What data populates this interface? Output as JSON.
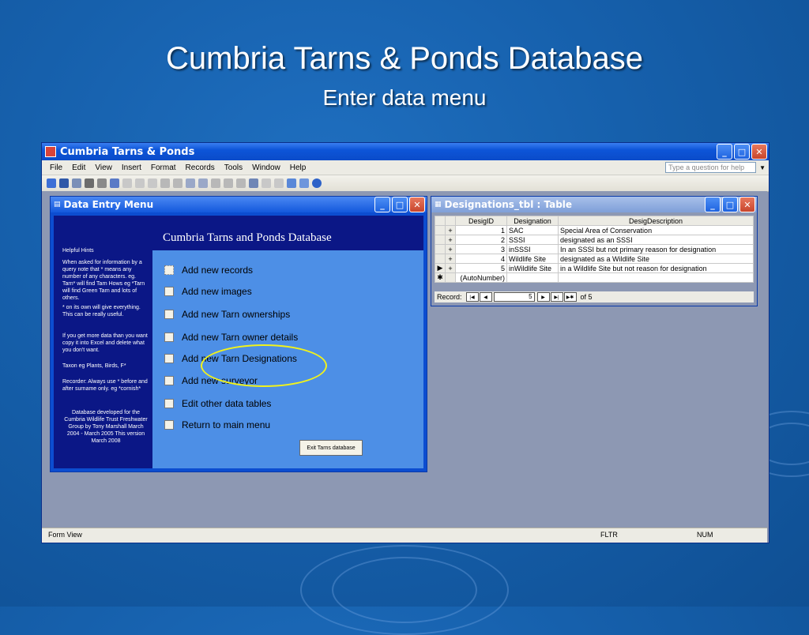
{
  "slide": {
    "title": "Cumbria Tarns & Ponds Database",
    "subtitle": "Enter data menu"
  },
  "app": {
    "title": "Cumbria Tarns & Ponds",
    "menu": [
      "File",
      "Edit",
      "View",
      "Insert",
      "Format",
      "Records",
      "Tools",
      "Window",
      "Help"
    ],
    "help_placeholder": "Type a question for help",
    "status": {
      "mode": "Form View",
      "filter": "FLTR",
      "num": "NUM"
    }
  },
  "menu_form": {
    "window_title": "Data Entry Menu",
    "heading": "Cumbria Tarns and Ponds Database",
    "hints": [
      "Helpful Hints",
      "When asked for information by a query note that * means any number of any characters. eg. Tarn* will find Tarn Hows eg *Tarn will find Green Tarn and lots of others.",
      "* on its own will give everything. This can be really useful.",
      "If you get more data than you want copy it into Excel and delete what you don't want.",
      "Taxon eg Plants, Birds, F*",
      "Recorder: Always use * before and after surname only. eg *cornish*",
      "Database developed for the Cumbria Wildlife Trust Freshwater Group by Tony Marshall March 2004 - March 2005 This version March 2008"
    ],
    "items": [
      "Add new records",
      "Add new images",
      "Add new Tarn ownerships",
      "Add new Tarn owner details",
      "Add new Tarn Designations",
      "Add new surveyor",
      "Edit other data tables",
      "Return to main menu"
    ],
    "exit_label": "Exit Tarns database"
  },
  "table_window": {
    "title": "Designations_tbl : Table",
    "columns": [
      "DesigID",
      "Designation",
      "DesigDescription"
    ],
    "rows": [
      [
        "1",
        "SAC",
        "Special Area of Conservation"
      ],
      [
        "2",
        "SSSI",
        "designated as an SSSI"
      ],
      [
        "3",
        "inSSSI",
        "In an SSSI but not primary reason for designation"
      ],
      [
        "4",
        "Wildlife Site",
        "designated as a Wildlife Site"
      ],
      [
        "5",
        "inWildlife Site",
        "in a Wildlife Site but not reason for designation"
      ]
    ],
    "new_row_placeholder": "(AutoNumber)",
    "record_label": "Record:",
    "record_current": "5",
    "record_total": "of 5"
  }
}
